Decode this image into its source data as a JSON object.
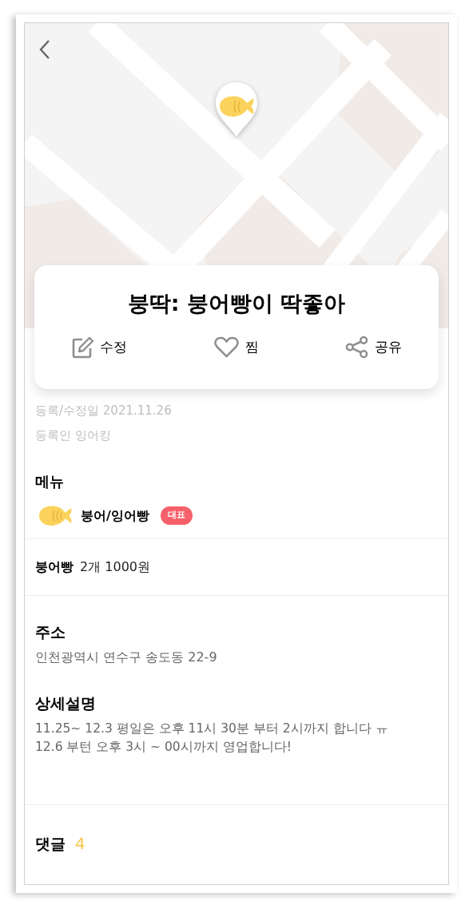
{
  "map": {
    "kind": "picture"
  },
  "title": "붕딱: 붕어빵이 딱좋아",
  "actions": [
    {
      "kind": "edit",
      "label": "수정"
    },
    {
      "kind": "like",
      "label": "찜"
    },
    {
      "kind": "share",
      "label": "공유"
    }
  ],
  "meta": [
    "등록/수정일 2021.11.26",
    "등록인 잉어킹"
  ],
  "menu": {
    "heading": "메뉴",
    "items": [
      {
        "name": "붕어/잉어빵",
        "badge": "대표"
      }
    ]
  },
  "price": {
    "name": "붕어빵",
    "value": "2개 1000원"
  },
  "address": {
    "heading": "주소",
    "text": "인천광역시 연수구 송도동 22-9"
  },
  "description": {
    "heading": "상세설명",
    "lines": [
      "11.25~ 12.3 평일은 오후 11시 30분 부터 2시까지 합니다 ㅠ",
      "12.6 부턴 오후 3시 ~ 00시까지 영업합니다!"
    ]
  },
  "comments": {
    "label": "댓글",
    "count": "4"
  }
}
